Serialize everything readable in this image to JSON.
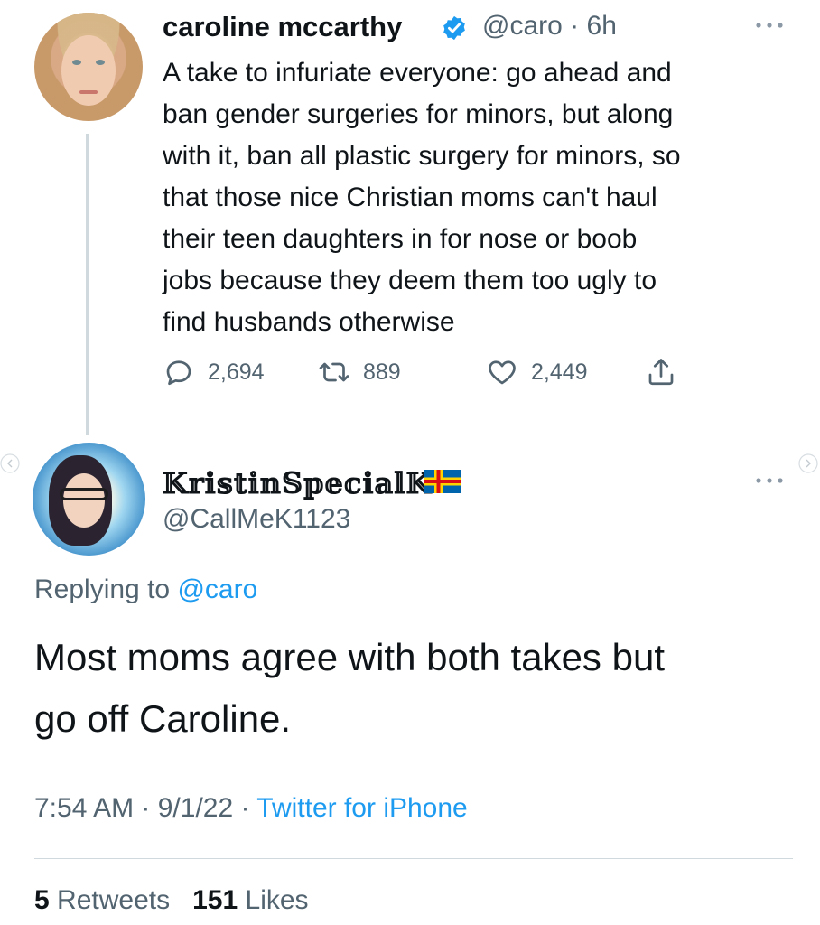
{
  "tweet": {
    "author": {
      "name": "caroline mccarthy",
      "handle": "@caro",
      "time": "6h",
      "verified": true
    },
    "separator": "·",
    "text": "A take to infuriate everyone: go ahead and\nban gender surgeries for minors, but along\nwith it, ban all plastic surgery for minors, so\nthat those nice Christian moms can't haul\ntheir teen daughters in for nose or boob\njobs because they deem them too ugly to\nfind husbands otherwise",
    "actions": {
      "replies": "2,694",
      "retweets": "889",
      "likes": "2,449"
    }
  },
  "reply": {
    "author": {
      "name": "𝕂𝕣𝕚𝕤𝕥𝕚𝕟𝕊𝕡𝕖𝕔𝕚𝕒𝕝𝕂",
      "handle": "@CallMeK1123",
      "flag": "Åland flag"
    },
    "replying_prefix": "Replying to",
    "replying_to": "@caro",
    "text": "Most moms agree with both takes but\ngo off Caroline.",
    "meta": {
      "time": "7:54 AM",
      "separator": " · ",
      "date": "9/1/22",
      "source": "Twitter for iPhone"
    },
    "stats": {
      "retweets_count": "5",
      "retweets_label": "Retweets",
      "likes_count": "151",
      "likes_label": "Likes"
    }
  },
  "icons": {
    "reply": "reply-icon",
    "retweet": "retweet-icon",
    "like": "heart-icon",
    "share": "share-icon",
    "verified": "verified-badge-icon",
    "more": "more-icon"
  },
  "colors": {
    "text": "#0f1419",
    "secondary": "#536471",
    "accent": "#1d9bf0",
    "border": "#cfd9de"
  }
}
